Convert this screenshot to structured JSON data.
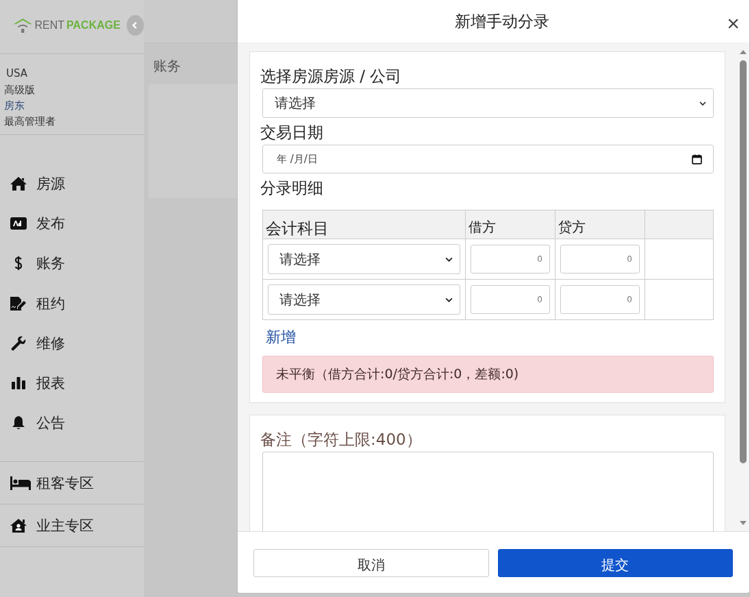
{
  "sidebar": {
    "logo": {
      "word_1": "RENT",
      "word_2": "PACKAGE"
    },
    "account": [
      {
        "text": "USA",
        "kind": "text"
      },
      {
        "text": "高级版",
        "kind": "text"
      },
      {
        "text": "房东",
        "kind": "link"
      },
      {
        "text": "最高管理者",
        "kind": "text"
      }
    ],
    "nav": [
      {
        "label": "房源"
      },
      {
        "label": "发布"
      },
      {
        "label": "账务"
      },
      {
        "label": "租约"
      },
      {
        "label": "维修"
      },
      {
        "label": "报表"
      },
      {
        "label": "公告"
      }
    ],
    "zones": [
      {
        "label": "租客专区"
      },
      {
        "label": "业主专区"
      }
    ]
  },
  "page": {
    "title": "账务"
  },
  "dialog": {
    "title": "新增手动分录",
    "close": "×",
    "property": {
      "label": "选择房源房源 / 公司",
      "value": "请选择"
    },
    "date": {
      "label": "交易日期",
      "placeholder": "年 /月/日"
    },
    "entries": {
      "label": "分录明细",
      "columns": [
        "会计科目",
        "借方",
        "贷方"
      ],
      "rows": [
        {
          "account": "请选择",
          "debit_placeholder": "0",
          "credit_placeholder": "0"
        },
        {
          "account": "请选择",
          "debit_placeholder": "0",
          "credit_placeholder": "0"
        }
      ],
      "add_link": "新增"
    },
    "alert": "未平衡（借方合计:0/贷方合计:0，差额:0)",
    "notes": {
      "label": "备注（字符上限:400）"
    },
    "buttons": [
      {
        "label": "取消",
        "kind": "secondary"
      },
      {
        "label": "提交",
        "kind": "primary"
      }
    ]
  }
}
